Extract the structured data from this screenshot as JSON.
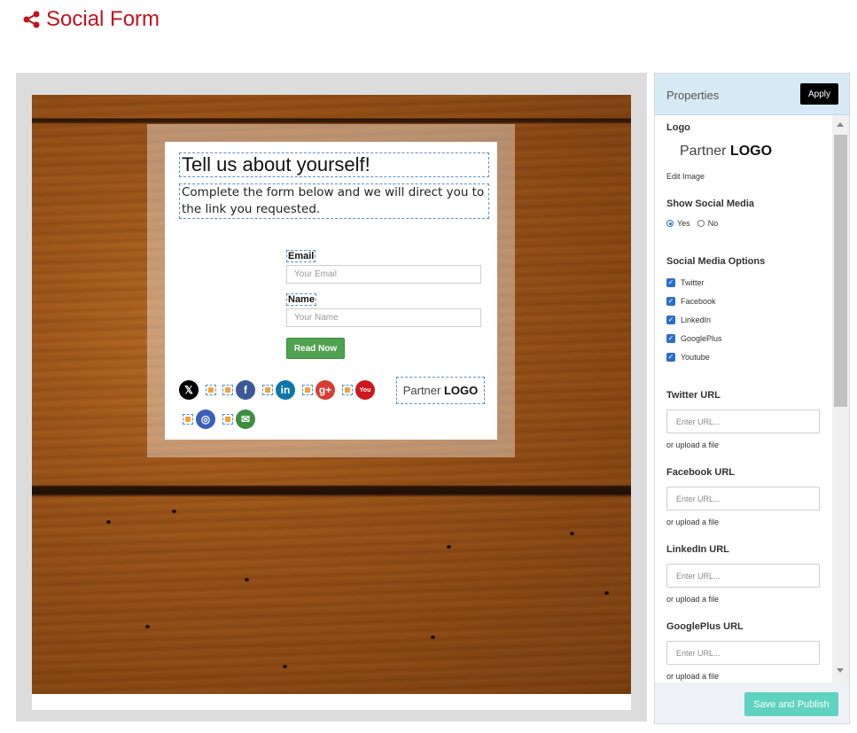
{
  "app": {
    "title": "Social Form"
  },
  "form": {
    "title": "Tell us about yourself!",
    "description": "Complete the form below and we will direct you to the link you requested.",
    "email_label": "Email",
    "email_placeholder": "Your Email",
    "name_label": "Name",
    "name_placeholder": "Your Name",
    "submit_label": "Read Now",
    "partner_logo_light": "Partner",
    "partner_logo_bold": "LOGO",
    "social_icons": [
      {
        "icon": "x-twitter-icon",
        "glyph": "𝕏",
        "color": "#000000"
      },
      {
        "icon": "facebook-icon",
        "glyph": "f",
        "color": "#3b5998"
      },
      {
        "icon": "linkedin-icon",
        "glyph": "in",
        "color": "#0e76a8"
      },
      {
        "icon": "googleplus-icon",
        "glyph": "g+",
        "color": "#d73d32"
      },
      {
        "icon": "youtube-icon",
        "glyph": "You",
        "color": "#cc181e"
      },
      {
        "icon": "website-icon",
        "glyph": "◎",
        "color": "#3b5eb8"
      },
      {
        "icon": "email-icon",
        "glyph": "✉",
        "color": "#3e8e41"
      }
    ]
  },
  "panel": {
    "title": "Properties",
    "apply_label": "Apply",
    "logo_label": "Logo",
    "logo_light": "Partner",
    "logo_bold": "LOGO",
    "edit_image": "Edit Image",
    "show_social_label": "Show Social Media",
    "show_social_options": [
      "Yes",
      "No"
    ],
    "show_social_selected": "Yes",
    "social_options_label": "Social Media Options",
    "social_options": [
      "Twitter",
      "Facebook",
      "LinkedIn",
      "GooglePlus",
      "Youtube"
    ],
    "url_fields": [
      {
        "label": "Twitter URL",
        "placeholder": "Enter URL...",
        "upload": "or upload a file"
      },
      {
        "label": "Facebook URL",
        "placeholder": "Enter URL...",
        "upload": "or upload a file"
      },
      {
        "label": "LinkedIn URL",
        "placeholder": "Enter URL...",
        "upload": "or upload a file"
      },
      {
        "label": "GooglePlus URL",
        "placeholder": "Enter URL...",
        "upload": "or upload a file"
      }
    ],
    "publish_label": "Save and Publish"
  },
  "colors": {
    "brand": "#c1121f",
    "apply_bg": "#000000",
    "publish_bg": "#5fd3c0",
    "submit_bg": "#4fa24f",
    "checkbox": "#2b6fc9"
  }
}
